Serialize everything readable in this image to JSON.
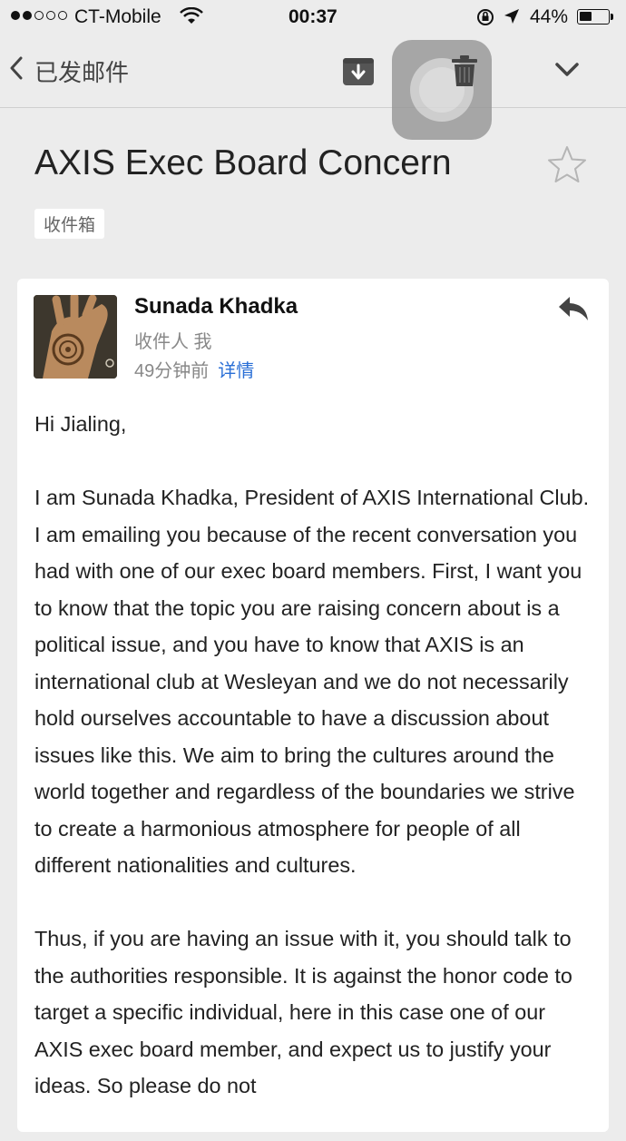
{
  "status_bar": {
    "carrier": "CT-Mobile",
    "time": "00:37",
    "battery_percent_text": "44%",
    "battery_level": 0.44,
    "signal_bars_filled": 2,
    "signal_bars_total": 5
  },
  "nav": {
    "back_label": "已发邮件",
    "icons": [
      "chevron-left-icon",
      "archive-icon",
      "trash-icon",
      "chevron-down-icon"
    ]
  },
  "email": {
    "subject": "AXIS Exec Board Concern",
    "label": "收件箱",
    "sender_name": "Sunada Khadka",
    "to_line": "收件人 我",
    "time_ago": "49分钟前",
    "details_link": "详情",
    "greeting": "Hi Jialing,",
    "paragraphs": [
      "I am Sunada Khadka, President of AXIS International Club. I am emailing you because of the recent conversation you had with one of our exec board members. First, I want you to know that the topic you are raising concern about is a political issue, and you have to know that AXIS is an international club at Wesleyan and we do not necessarily hold ourselves accountable to have a discussion about issues like this. We aim to bring the cultures around the world together and regardless of the boundaries we strive to create a harmonious atmosphere for people of all different nationalities and cultures.",
      "Thus, if you are having an issue with it, you should talk to the authorities responsible. It is against the honor code to target a specific individual, here in this case one of our AXIS exec board member, and expect us to justify your ideas. So please do not"
    ]
  },
  "colors": {
    "background": "#ececec",
    "card": "#ffffff",
    "link": "#2a6fd6"
  }
}
